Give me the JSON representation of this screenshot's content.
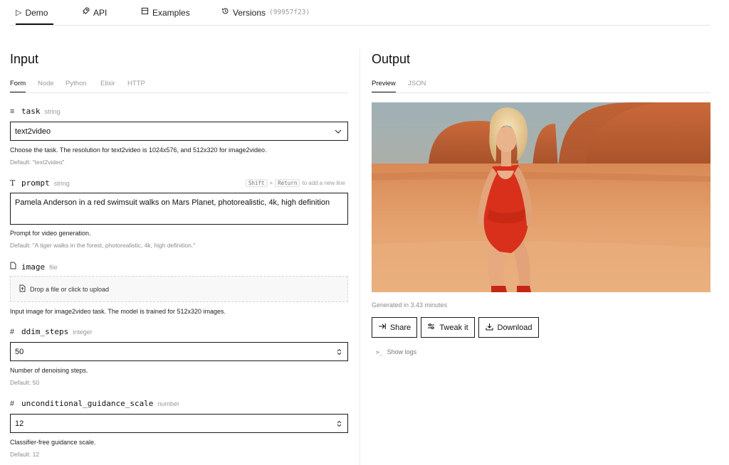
{
  "nav": {
    "demo": "Demo",
    "api": "API",
    "examples": "Examples",
    "versions": "Versions",
    "version_hash": "(99957f23)"
  },
  "input": {
    "title": "Input",
    "tabs": [
      "Form",
      "Node",
      "Python",
      "Elixir",
      "HTTP"
    ],
    "fields": {
      "task": {
        "name": "task",
        "type": "string",
        "value": "text2video",
        "help": "Choose the task. The resolution for text2video is 1024x576, and 512x320 for image2video.",
        "default": "Default: \"text2video\""
      },
      "prompt": {
        "name": "prompt",
        "type": "string",
        "value": "Pamela Anderson in a red swimsuit walks on Mars Planet, photorealistic, 4k, high definition",
        "hint_key1": "Shift",
        "hint_plus": "+",
        "hint_key2": "Return",
        "hint_text": "to add a new line",
        "help": "Prompt for video generation.",
        "default": "Default: \"A tiger walks in the forest, photorealistic, 4k, high definition.\""
      },
      "image": {
        "name": "image",
        "type": "file",
        "upload_text": "Drop a file or click to upload",
        "help": "Input image for image2video task. The model is trained for 512x320 images."
      },
      "ddim_steps": {
        "name": "ddim_steps",
        "type": "integer",
        "value": "50",
        "help": "Number of denoising steps.",
        "default": "Default: 50"
      },
      "guidance": {
        "name": "unconditional_guidance_scale",
        "type": "number",
        "value": "12",
        "help": "Classifier-free guidance scale.",
        "default": "Default: 12"
      }
    }
  },
  "output": {
    "title": "Output",
    "tabs": [
      "Preview",
      "JSON"
    ],
    "generated": "Generated in 3.43 minutes",
    "buttons": {
      "share": "Share",
      "tweak": "Tweak it",
      "download": "Download"
    },
    "logs": "Show logs"
  }
}
